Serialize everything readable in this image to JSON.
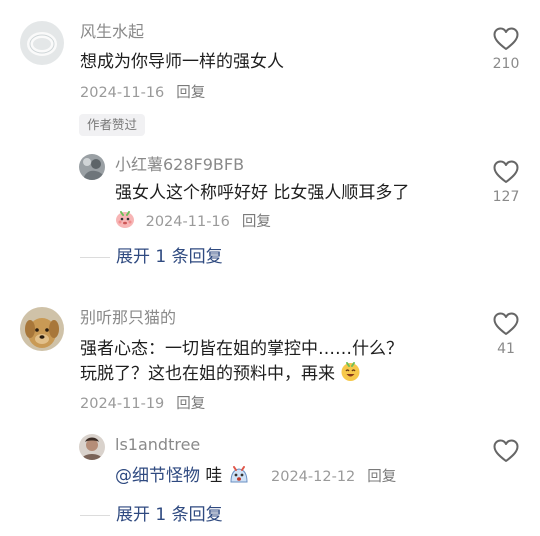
{
  "comments": [
    {
      "username": "风生水起",
      "text": "想成为你导师一样的强女人",
      "date": "2024-11-16",
      "reply_label": "回复",
      "author_badge": "作者赞过",
      "likes": "210",
      "avatar_icon": "white-ring-avatar",
      "replies": [
        {
          "username": "小红薯628F9BFB",
          "text": "强女人这个称呼好好 比女强人顺耳多了",
          "emoji_icon": "shy-pink-face-emoji",
          "date": "2024-11-16",
          "reply_label": "回复",
          "likes": "127",
          "avatar_icon": "gray-silhouette-avatar"
        }
      ],
      "expand_label": "展开 1 条回复"
    },
    {
      "username": "别听那只猫的",
      "text_line1": "强者心态：一切皆在姐的掌控中……什么？",
      "text_line2": "玩脱了？这也在姐的预料中，再来",
      "text_emoji_icon": "grinning-face-emoji",
      "date": "2024-11-19",
      "reply_label": "回复",
      "likes": "41",
      "avatar_icon": "golden-puppy-avatar",
      "replies": [
        {
          "username": "ls1andtree",
          "mention": "@细节怪物",
          "text": " 哇",
          "emoji_icon": "wow-face-emoji",
          "date": "2024-12-12",
          "reply_label": "回复",
          "avatar_icon": "person-photo-avatar"
        }
      ],
      "expand_label": "展开 1 条回复"
    }
  ],
  "colors": {
    "username": "#8a8a8a",
    "text": "#1e1e1e",
    "expand_link": "#2f4a80",
    "like_outline": "#666666"
  }
}
